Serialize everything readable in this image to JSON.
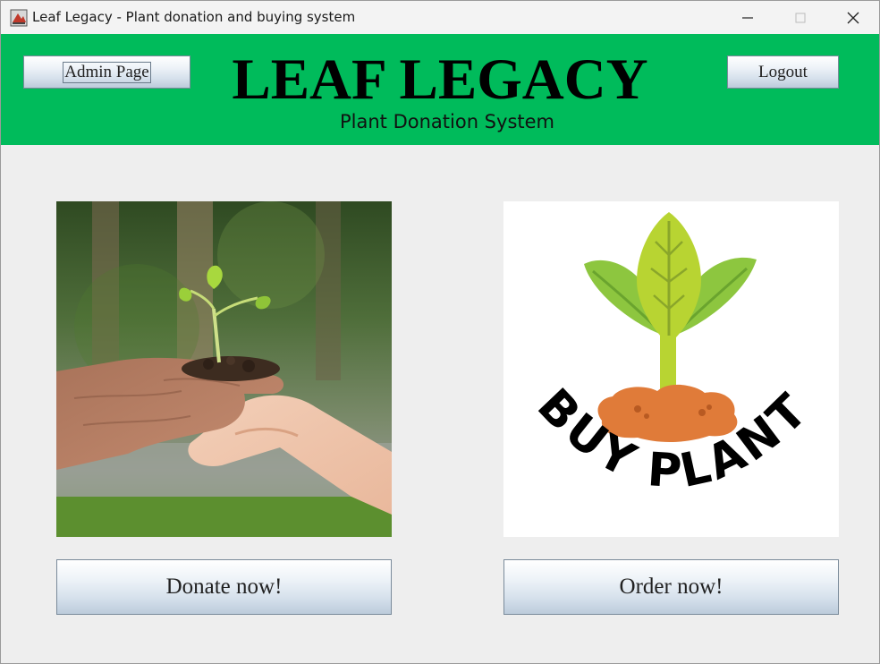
{
  "window": {
    "title": "Leaf Legacy - Plant donation and buying system",
    "icons": [
      "app-icon",
      "minimize-icon",
      "maximize-icon",
      "close-icon"
    ]
  },
  "header": {
    "admin_label": "Admin Page",
    "logout_label": "Logout",
    "title": "LEAF LEGACY",
    "subtitle": "Plant Donation System",
    "background": "#00bb5b"
  },
  "cards": {
    "buy_logo_text": "BUY PLANT",
    "donate_label": "Donate now!",
    "order_label": "Order now!"
  }
}
